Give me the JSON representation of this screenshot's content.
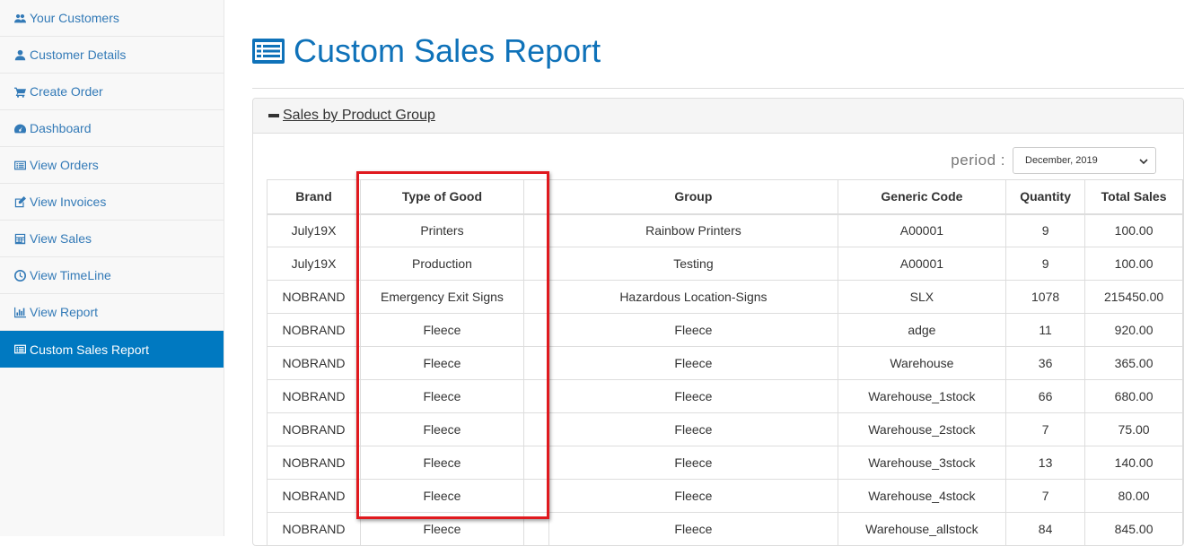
{
  "sidebar": {
    "items": [
      {
        "label": "Your Customers",
        "icon": "users-icon"
      },
      {
        "label": "Customer Details",
        "icon": "user-icon"
      },
      {
        "label": "Create Order",
        "icon": "shopping-cart-icon"
      },
      {
        "label": "Dashboard",
        "icon": "dashboard-icon"
      },
      {
        "label": "View Orders",
        "icon": "list-alt-icon"
      },
      {
        "label": "View Invoices",
        "icon": "edit-icon"
      },
      {
        "label": "View Sales",
        "icon": "calculator-icon"
      },
      {
        "label": "View TimeLine",
        "icon": "clock-icon"
      },
      {
        "label": "View Report",
        "icon": "bar-chart-icon"
      },
      {
        "label": "Custom Sales Report",
        "icon": "list-alt-icon"
      }
    ]
  },
  "page": {
    "title": "Custom Sales Report",
    "accent": "#0f72b9",
    "active_nav": "#0079c1"
  },
  "panel": {
    "heading": " Sales by Product Group",
    "period_label": "period :",
    "period_value": "December, 2019"
  },
  "table": {
    "headers": [
      "Brand",
      "Type of Good",
      "",
      "Group",
      "Generic Code",
      "Quantity",
      "Total Sales"
    ],
    "rows": [
      [
        "July19X",
        "Printers",
        "",
        "Rainbow Printers",
        "A00001",
        "9",
        "100.00"
      ],
      [
        "July19X",
        "Production",
        "",
        "Testing",
        "A00001",
        "9",
        "100.00"
      ],
      [
        "NOBRAND",
        "Emergency Exit Signs",
        "",
        "Hazardous Location-Signs",
        "SLX",
        "1078",
        "215450.00"
      ],
      [
        "NOBRAND",
        "Fleece",
        "",
        "Fleece",
        "adge",
        "11",
        "920.00"
      ],
      [
        "NOBRAND",
        "Fleece",
        "",
        "Fleece",
        "Warehouse",
        "36",
        "365.00"
      ],
      [
        "NOBRAND",
        "Fleece",
        "",
        "Fleece",
        "Warehouse_1stock",
        "66",
        "680.00"
      ],
      [
        "NOBRAND",
        "Fleece",
        "",
        "Fleece",
        "Warehouse_2stock",
        "7",
        "75.00"
      ],
      [
        "NOBRAND",
        "Fleece",
        "",
        "Fleece",
        "Warehouse_3stock",
        "13",
        "140.00"
      ],
      [
        "NOBRAND",
        "Fleece",
        "",
        "Fleece",
        "Warehouse_4stock",
        "7",
        "80.00"
      ],
      [
        "NOBRAND",
        "Fleece",
        "",
        "Fleece",
        "Warehouse_allstock",
        "84",
        "845.00"
      ]
    ]
  },
  "annotation": {
    "color": "#e0191e"
  }
}
